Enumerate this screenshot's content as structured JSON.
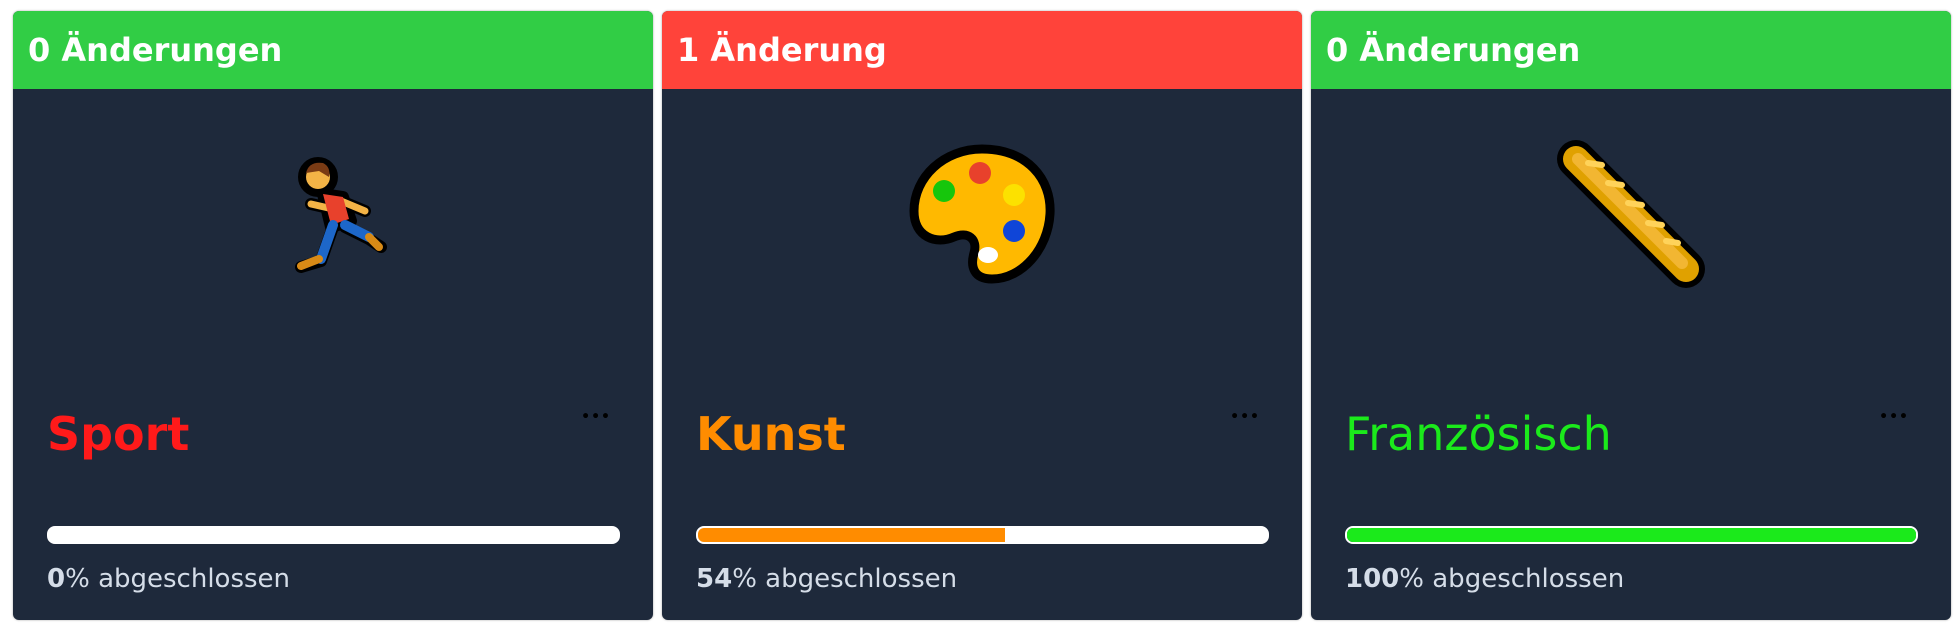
{
  "cards": [
    {
      "header": "0 Änderungen",
      "header_color": "#31cd45",
      "icon": "running-person-icon",
      "subject": "Sport",
      "subject_color": "#ff1a1a",
      "more": "•••",
      "progress_percent": 0,
      "progress_value": "0",
      "progress_suffix": "% abgeschlossen",
      "progress_color": "#ffffff"
    },
    {
      "header": "1 Änderung",
      "header_color": "#ff433a",
      "icon": "artist-palette-icon",
      "subject": "Kunst",
      "subject_color": "#ff8c00",
      "more": "•••",
      "progress_percent": 54,
      "progress_value": "54",
      "progress_suffix": "% abgeschlossen",
      "progress_color": "#ff8c00"
    },
    {
      "header": "0 Änderungen",
      "header_color": "#31cd45",
      "icon": "baguette-bread-icon",
      "subject": "Französisch",
      "subject_color": "#1bea1b",
      "more": "•••",
      "progress_percent": 100,
      "progress_value": "100",
      "progress_suffix": "% abgeschlossen",
      "progress_color": "#1bea1b"
    }
  ]
}
